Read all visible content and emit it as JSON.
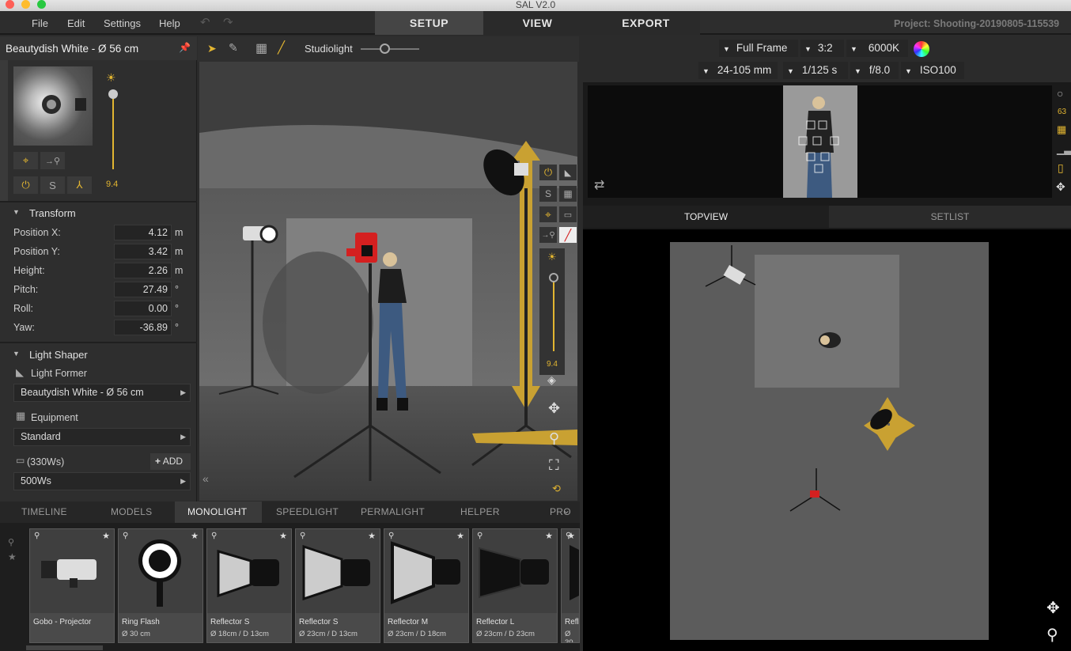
{
  "window": {
    "title": "SAL V2.0"
  },
  "menu": {
    "items": [
      "File",
      "Edit",
      "Settings",
      "Help"
    ]
  },
  "modes": {
    "tabs": [
      "SETUP",
      "VIEW",
      "EXPORT"
    ],
    "active": "SETUP"
  },
  "project": {
    "label": "Project: Shooting-20190805-115539"
  },
  "light": {
    "name": "Beautydish White - Ø 56 cm",
    "intensity": "9.4"
  },
  "transform": {
    "heading": "Transform",
    "rows": [
      {
        "label": "Position X:",
        "value": "4.12",
        "unit": "m"
      },
      {
        "label": "Position Y:",
        "value": "3.42",
        "unit": "m"
      },
      {
        "label": "Height:",
        "value": "2.26",
        "unit": "m"
      },
      {
        "label": "Pitch:",
        "value": "27.49",
        "unit": "°"
      },
      {
        "label": "Roll:",
        "value": "0.00",
        "unit": "°"
      },
      {
        "label": "Yaw:",
        "value": "-36.89",
        "unit": "°"
      }
    ]
  },
  "shaper": {
    "heading": "Light Shaper",
    "former_label": "Light Former",
    "former_value": "Beautydish White - Ø 56 cm",
    "equipment_label": "Equipment",
    "equipment_value": "Standard",
    "power_label": "(330Ws)",
    "add_label": "ADD",
    "power_value": "500Ws"
  },
  "viewport": {
    "studiolight_label": "Studiolight",
    "studiolight_level": 0.4,
    "side_intensity": "9.4"
  },
  "camera": {
    "sensor": "Full Frame",
    "ratio": "3:2",
    "whitebalance": "6000K",
    "lens": "24-105 mm",
    "shutter": "1/125 s",
    "aperture": "f/8.0",
    "iso": "ISO100",
    "side_value": "63"
  },
  "views": {
    "tabs": [
      "TOPVIEW",
      "SETLIST"
    ],
    "active": "TOPVIEW"
  },
  "library": {
    "tabs": [
      "TIMELINE",
      "MODELS",
      "MONOLIGHT",
      "SPEEDLIGHT",
      "PERMALIGHT",
      "HELPER",
      "PROPS"
    ],
    "active": "MONOLIGHT",
    "items": [
      {
        "name": "Gobo - Projector",
        "sub": ""
      },
      {
        "name": "Ring Flash",
        "sub": "Ø 30 cm"
      },
      {
        "name": "Reflector S",
        "sub": "Ø 18cm / D 13cm"
      },
      {
        "name": "Reflector S",
        "sub": "Ø 23cm / D 13cm"
      },
      {
        "name": "Reflector M",
        "sub": "Ø 23cm / D 18cm"
      },
      {
        "name": "Reflector L",
        "sub": "Ø 23cm / D 23cm"
      },
      {
        "name": "Refl",
        "sub": "Ø 30"
      }
    ]
  },
  "colors": {
    "accent": "#e2b531",
    "panel": "#2e2e2e",
    "light_red": "#d42020"
  }
}
